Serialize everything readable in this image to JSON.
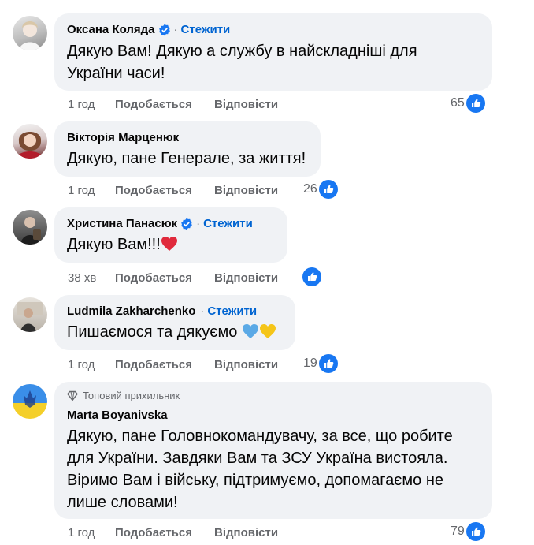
{
  "top_cut_text": "...",
  "comments": [
    {
      "author": "Оксана Коляда",
      "verified": true,
      "follow": "Стежити",
      "lines": [
        "Дякую Вам! Дякую а службу в найскладніші для",
        "України часи!"
      ],
      "time": "1 год",
      "like": "Подобається",
      "reply": "Відповісти",
      "reactions": "65"
    },
    {
      "author": "Вікторія Марценюк",
      "verified": false,
      "follow": "",
      "lines": [
        "Дякую, пане Генерале, за життя!"
      ],
      "time": "1 год",
      "like": "Подобається",
      "reply": "Відповісти",
      "reactions": "26"
    },
    {
      "author": "Христина Панасюк",
      "verified": true,
      "follow": "Стежити",
      "lines": [
        "Дякую Вам!!!"
      ],
      "emoji": [
        "red-heart"
      ],
      "time": "38 хв",
      "like": "Подобається",
      "reply": "Відповісти",
      "reactions": ""
    },
    {
      "author": "Ludmila Zakharchenko",
      "verified": false,
      "follow": "Стежити",
      "lines": [
        "Пишаємося та дякуємо "
      ],
      "emoji": [
        "blue-heart",
        "yellow-heart"
      ],
      "time": "1 год",
      "like": "Подобається",
      "reply": "Відповісти",
      "reactions": "19"
    },
    {
      "badge": "Топовий прихильник",
      "author": "Marta Boyanivska",
      "verified": false,
      "follow": "",
      "lines": [
        "Дякую, пане Головнокомандувачу, за все, що робите",
        "для України. Завдяки Вам та ЗСУ Україна вистояла.",
        "Віримо Вам і війську, підтримуємо, допомагаємо не",
        "лише словами!"
      ],
      "time": "1 год",
      "like": "Подобається",
      "reply": "Відповісти",
      "reactions": "79"
    }
  ],
  "colors": {
    "bubble": "#f0f2f5",
    "link_blue": "#0064d1",
    "like_blue": "#1877f2",
    "meta_gray": "#65676b"
  }
}
